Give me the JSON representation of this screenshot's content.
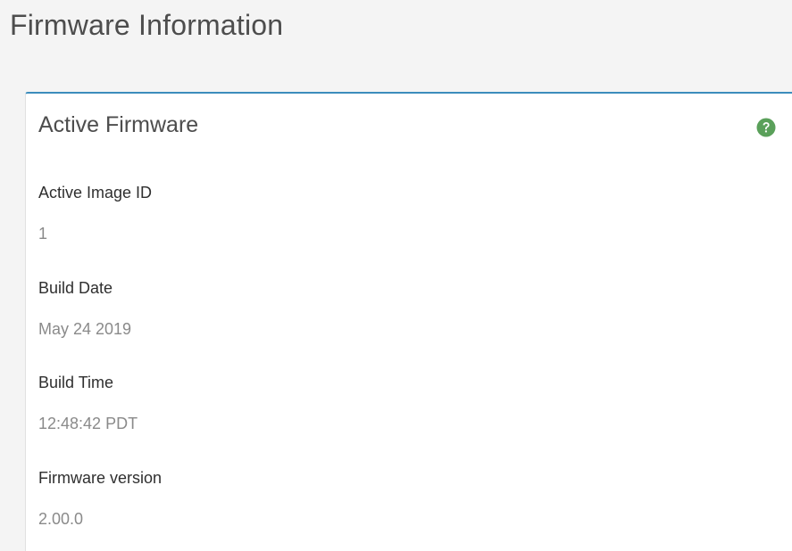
{
  "page": {
    "title": "Firmware Information"
  },
  "panel": {
    "title": "Active Firmware",
    "help_icon": "question-circle-icon",
    "accent_color": "#3c8dbc",
    "help_icon_color": "#5aa05a",
    "fields": [
      {
        "label": "Active Image ID",
        "value": "1"
      },
      {
        "label": "Build Date",
        "value": "May 24 2019"
      },
      {
        "label": "Build Time",
        "value": "12:48:42 PDT"
      },
      {
        "label": "Firmware version",
        "value": "2.00.0"
      }
    ]
  }
}
